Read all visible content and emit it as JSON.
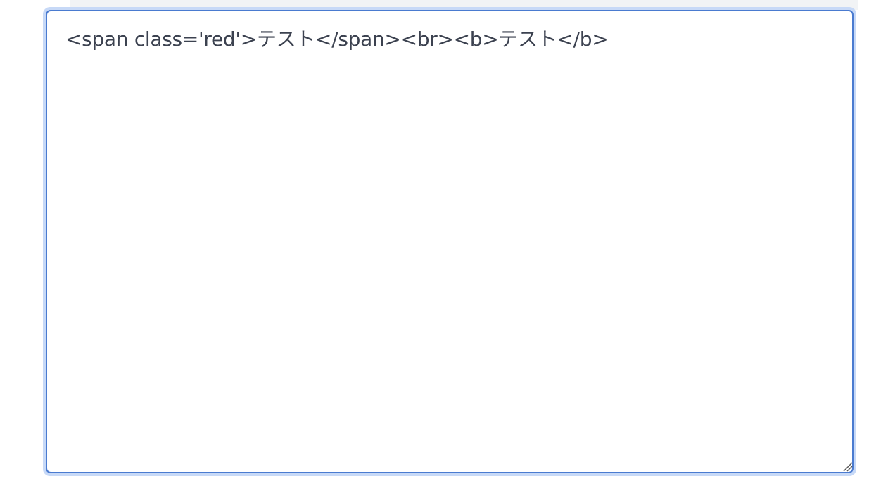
{
  "editor": {
    "value": "<span class='red'>テスト</span><br><b>テスト</b>"
  },
  "icons": {
    "resize": "resize-grip-icon"
  },
  "colors": {
    "border": "#4a7bd0",
    "focus_ring": "#c7d9f7",
    "text": "#3c4250",
    "background": "#ffffff"
  }
}
